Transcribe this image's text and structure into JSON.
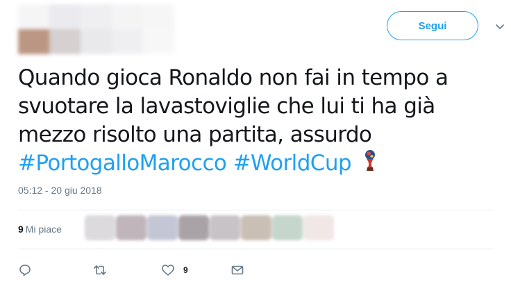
{
  "tweet": {
    "follow_label": "Segui",
    "text_lines": [
      "Quando gioca Ronaldo non fai in tempo a",
      "svuotare la lavastoviglie che lui ti ha già",
      "mezzo risolto una partita, assurdo"
    ],
    "hashtags": [
      "#PortogalloMarocco",
      "#WorldCup"
    ],
    "timestamp": "05:12 - 20 giu 2018",
    "likes_count": "9",
    "likes_label": "Mi piace",
    "action_like_count": "9"
  },
  "colors": {
    "accent": "#1da1f2",
    "muted": "#657786",
    "text": "#14171a",
    "divider": "#e6ecf0"
  },
  "icons": {
    "chevron": "chevron-down-icon",
    "trophy": "world-cup-trophy-emoji",
    "reply": "reply-icon",
    "retweet": "retweet-icon",
    "like": "heart-icon",
    "message": "envelope-icon"
  }
}
